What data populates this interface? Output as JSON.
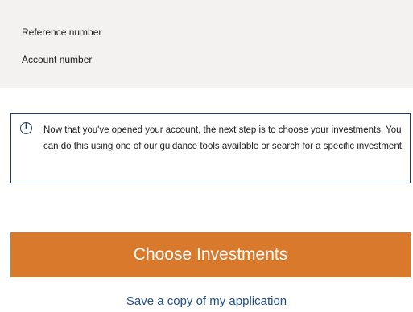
{
  "reference_panel": {
    "reference_label": "Reference number",
    "account_label": "Account number"
  },
  "info_notice": {
    "icon": "info-icon",
    "icon_glyph": "i",
    "text": "Now that you've opened your account, the next step is to choose your investments. You can do this using one of our guidance tools available or search for a specific investment."
  },
  "actions": {
    "choose_label": "Choose Investments",
    "save_link_label": "Save a copy of my application"
  },
  "colors": {
    "primary_button": "#d9792b",
    "notice_border": "#1b3a6b",
    "link": "#1f4f8c",
    "panel_background": "#f3f2f0"
  }
}
